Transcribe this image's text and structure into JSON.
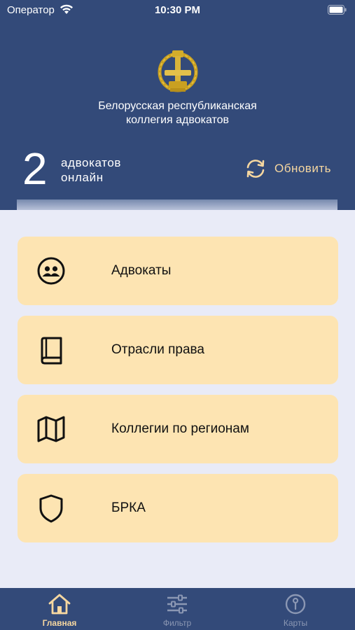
{
  "status_bar": {
    "carrier": "Оператор",
    "time": "10:30 PM",
    "wifi_icon": "wifi-icon",
    "battery_icon": "battery-icon"
  },
  "header": {
    "logo_icon": "bar-association-emblem",
    "title_line1": "Белорусская республиканская",
    "title_line2": "коллегия адвокатов",
    "online_count": "2",
    "online_label_line1": "адвокатов",
    "online_label_line2": "онлайн",
    "refresh_label": "Обновить",
    "refresh_icon": "refresh-icon"
  },
  "menu": {
    "items": [
      {
        "label": "Адвокаты",
        "icon": "people-icon"
      },
      {
        "label": "Отрасли права",
        "icon": "book-icon"
      },
      {
        "label": "Коллегии по регионам",
        "icon": "map-icon"
      },
      {
        "label": "БРКА",
        "icon": "shield-icon"
      }
    ]
  },
  "tabbar": {
    "tabs": [
      {
        "label": "Главная",
        "icon": "home-icon",
        "active": true
      },
      {
        "label": "Фильтр",
        "icon": "filter-icon",
        "active": false
      },
      {
        "label": "Карты",
        "icon": "map-pin-icon",
        "active": false
      }
    ]
  },
  "colors": {
    "header_bg": "#334a79",
    "card_bg": "#fde4b2",
    "accent": "#f6d7a0",
    "page_bg": "#e9ebf7",
    "tab_inactive": "#8b97b3"
  }
}
